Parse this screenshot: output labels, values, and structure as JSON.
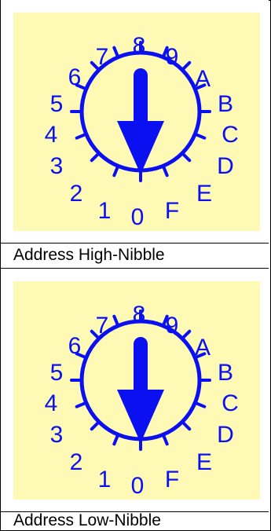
{
  "colors": {
    "panel_bg": "#fff9b6",
    "dial": "#0a10f0",
    "border": "#000000"
  },
  "switches": [
    {
      "caption": "Address High-Nibble",
      "labels": [
        "0",
        "1",
        "2",
        "3",
        "4",
        "5",
        "6",
        "7",
        "8",
        "9",
        "A",
        "B",
        "C",
        "D",
        "E",
        "F"
      ],
      "pointer_value": "0"
    },
    {
      "caption": "Address Low-Nibble",
      "labels": [
        "0",
        "1",
        "2",
        "3",
        "4",
        "5",
        "6",
        "7",
        "8",
        "9",
        "A",
        "B",
        "C",
        "D",
        "E",
        "F"
      ],
      "pointer_value": "0"
    }
  ]
}
